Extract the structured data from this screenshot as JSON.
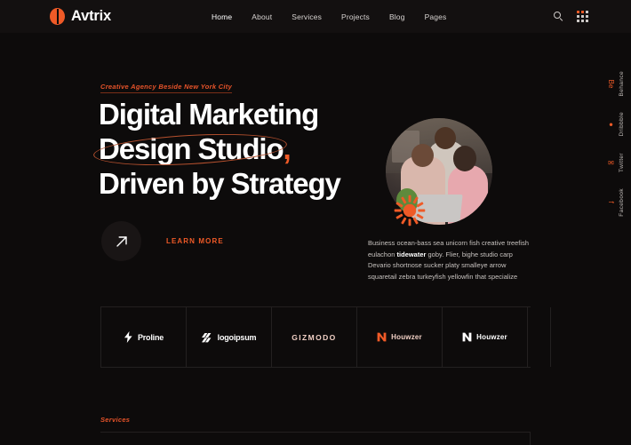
{
  "brand": {
    "name": "Avtrix",
    "accent": "#ef5a27",
    "bg": "#0d0b0b"
  },
  "header": {
    "nav": [
      {
        "label": "Home",
        "active": true
      },
      {
        "label": "About",
        "active": false
      },
      {
        "label": "Services",
        "active": false
      },
      {
        "label": "Projects",
        "active": false
      },
      {
        "label": "Blog",
        "active": false
      },
      {
        "label": "Pages",
        "active": false
      }
    ],
    "search_icon": "search-icon",
    "menu_icon": "grid-dots-icon"
  },
  "hero": {
    "eyebrow": "Creative Agency Beside New York City",
    "headline_line1": "Digital Marketing",
    "headline_line2_a": "Design",
    "headline_line2_b": " Studio",
    "headline_line2_comma": ",",
    "headline_line3": "Driven by Strategy",
    "cta_label": "LEARN MORE",
    "cta_icon": "arrow-up-right-icon",
    "paragraph_1": "Business ocean-bass sea unicorn fish creative treefish eulachon ",
    "paragraph_bold": "tidewater",
    "paragraph_2": " goby. Flier, bighe studio carp Devario shortnose sucker platy smalleye arrow squaretail zebra turkeyfish yellowfin that specialize",
    "photo_alt": "team-collaboration-photo",
    "decor": "sunburst-shape"
  },
  "brands": [
    {
      "name": "Proline",
      "mark": "bolt-icon",
      "style": "white"
    },
    {
      "name": "logoipsum",
      "mark": "slashes-icon",
      "style": "white"
    },
    {
      "name": "GIZMODO",
      "mark": "none",
      "style": "peach"
    },
    {
      "name": "Houwzer",
      "mark": "n-icon",
      "style": "orange"
    },
    {
      "name": "Houwzer",
      "mark": "n-icon",
      "style": "white"
    }
  ],
  "social": [
    {
      "label": "Behance",
      "glyph": "Be",
      "icon": "behance-icon"
    },
    {
      "label": "Dribbble",
      "glyph": "●",
      "icon": "dribbble-icon"
    },
    {
      "label": "Twitter",
      "glyph": "✉",
      "icon": "twitter-icon"
    },
    {
      "label": "Facebook",
      "glyph": "f",
      "icon": "facebook-icon"
    }
  ],
  "services": {
    "tag": "Services"
  }
}
